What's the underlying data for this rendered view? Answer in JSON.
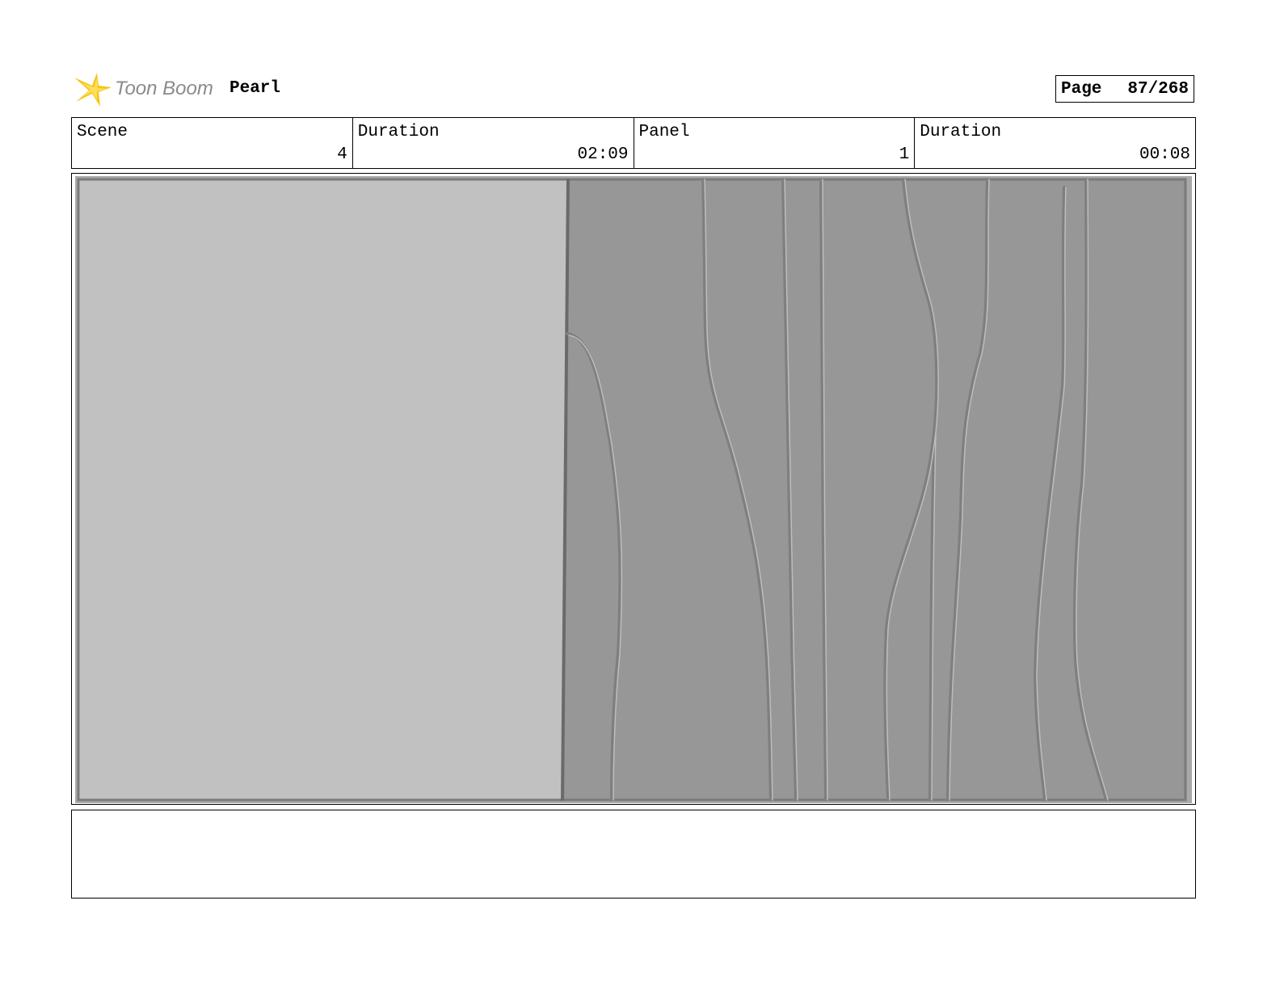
{
  "header": {
    "logo_text": "Toon Boom",
    "project_title": "Pearl",
    "page_label": "Page",
    "page_value": "87/268"
  },
  "info": {
    "scene_label": "Scene",
    "scene_value": "4",
    "scene_duration_label": "Duration",
    "scene_duration_value": "02:09",
    "panel_label": "Panel",
    "panel_value": "1",
    "panel_duration_label": "Duration",
    "panel_duration_value": "00:08"
  },
  "colors": {
    "logo_accent": "#f5c518",
    "left_wall": "#c1c1c1",
    "right_wall": "#979797",
    "frame_border": "#7a7a7a"
  },
  "notes": {
    "text": ""
  }
}
